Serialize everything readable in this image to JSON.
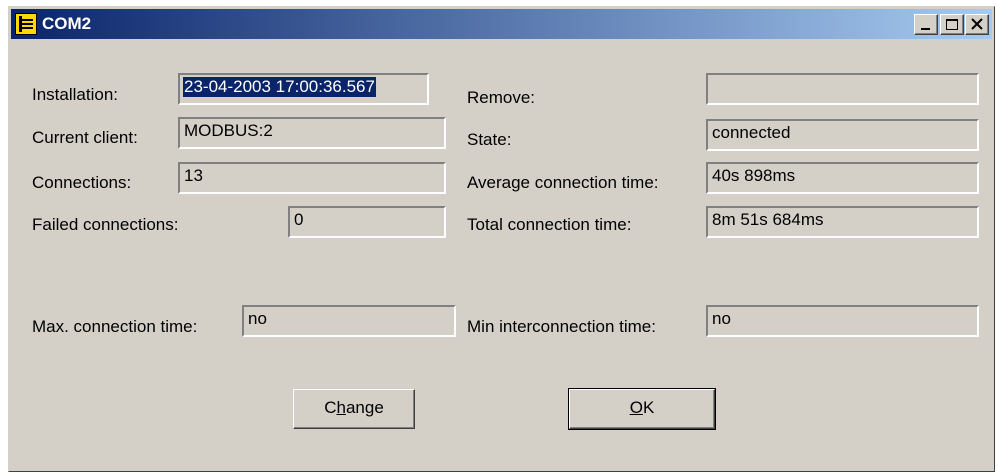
{
  "window": {
    "title": "COM2"
  },
  "fields": {
    "installation": {
      "label": "Installation:",
      "value": "23-04-2003 17:00:36.567"
    },
    "current_client": {
      "label": "Current client:",
      "value": "MODBUS:2"
    },
    "connections": {
      "label": "Connections:",
      "value": "13"
    },
    "failed_connections": {
      "label": "Failed connections:",
      "value": "0"
    },
    "remove": {
      "label": "Remove:",
      "value": ""
    },
    "state": {
      "label": "State:",
      "value": "connected"
    },
    "average_connection_time": {
      "label": "Average connection time:",
      "value": "40s 898ms"
    },
    "total_connection_time": {
      "label": "Total connection time:",
      "value": "8m 51s 684ms"
    },
    "max_connection_time": {
      "label": "Max. connection time:",
      "value": "no"
    },
    "min_interconnection_time": {
      "label": "Min interconnection time:",
      "value": "no"
    }
  },
  "buttons": {
    "change": {
      "pre": "C",
      "underline": "h",
      "post": "ange"
    },
    "ok": {
      "pre": "",
      "underline": "O",
      "post": "K"
    }
  },
  "colors": {
    "titlebar_start": "#0a246a",
    "titlebar_end": "#a6caf0",
    "face": "#d4d0c8",
    "selection": "#0a246a"
  },
  "icons": [
    "plug-icon",
    "minimize-icon",
    "maximize-icon",
    "close-icon"
  ]
}
